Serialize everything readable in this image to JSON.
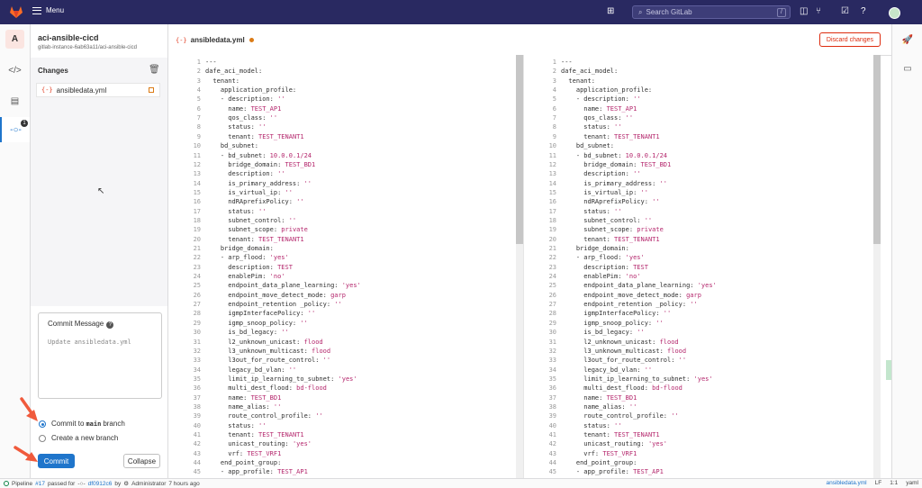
{
  "topbar": {
    "menu_label": "Menu",
    "search_placeholder": "Search GitLab",
    "search_shortcut": "/",
    "icons": [
      "plus-square-icon",
      "search-icon",
      "issues-icon",
      "merge-request-icon",
      "todo-icon",
      "help-icon",
      "user-avatar"
    ]
  },
  "project": {
    "avatar_letter": "A",
    "name": "aci-ansible-cicd",
    "path": "gitlab-instance-6ab63a11/aci-ansible-cicd"
  },
  "left_rail": {
    "items": [
      "edit-icon",
      "review-icon",
      "commit-icon"
    ],
    "commit_badge": "1"
  },
  "changes": {
    "title": "Changes",
    "files": [
      {
        "name": "ansibledata.yml",
        "icon": "yaml-file-icon",
        "status": "modified"
      }
    ]
  },
  "commit": {
    "message_label": "Commit Message",
    "message_placeholder": "Update ansibledata.yml",
    "option_main_prefix": "Commit to",
    "option_main_branch": "main",
    "option_main_suffix": "branch",
    "option_new": "Create a new branch",
    "commit_button": "Commit",
    "collapse_button": "Collapse"
  },
  "editor": {
    "file_tab": "ansibledata.yml",
    "discard_button": "Discard changes",
    "lines": [
      {
        "n": "1",
        "code": "---",
        "val": ""
      },
      {
        "n": "2",
        "code": "dafe_aci_model:",
        "val": ""
      },
      {
        "n": "3",
        "code": "  tenant:",
        "val": ""
      },
      {
        "n": "4",
        "code": "    application_profile:",
        "val": ""
      },
      {
        "n": "5",
        "code": "    - description: ",
        "val": "''"
      },
      {
        "n": "6",
        "code": "      name: ",
        "val": "TEST_AP1"
      },
      {
        "n": "7",
        "code": "      qos_class: ",
        "val": "''"
      },
      {
        "n": "8",
        "code": "      status: ",
        "val": "''"
      },
      {
        "n": "9",
        "code": "      tenant: ",
        "val": "TEST_TENANT1"
      },
      {
        "n": "10",
        "code": "    bd_subnet:",
        "val": ""
      },
      {
        "n": "11",
        "code": "    - bd_subnet: ",
        "val": "10.0.0.1/24"
      },
      {
        "n": "12",
        "code": "      bridge_domain: ",
        "val": "TEST_BD1"
      },
      {
        "n": "13",
        "code": "      description: ",
        "val": "''"
      },
      {
        "n": "14",
        "code": "      is_primary_address: ",
        "val": "''"
      },
      {
        "n": "15",
        "code": "      is_virtual_ip: ",
        "val": "''"
      },
      {
        "n": "16",
        "code": "      ndRAprefixPolicy: ",
        "val": "''"
      },
      {
        "n": "17",
        "code": "      status: ",
        "val": "''"
      },
      {
        "n": "18",
        "code": "      subnet_control: ",
        "val": "''"
      },
      {
        "n": "19",
        "code": "      subnet_scope: ",
        "val": "private"
      },
      {
        "n": "20",
        "code": "      tenant: ",
        "val": "TEST_TENANT1"
      },
      {
        "n": "21",
        "code": "    bridge_domain:",
        "val": ""
      },
      {
        "n": "22",
        "code": "    - arp_flood: ",
        "val": "'yes'"
      },
      {
        "n": "23",
        "code": "      description: ",
        "val": "TEST"
      },
      {
        "n": "24",
        "code": "      enablePim: ",
        "val": "'no'"
      },
      {
        "n": "25",
        "code": "      endpoint_data_plane_learning: ",
        "val": "'yes'"
      },
      {
        "n": "26",
        "code": "      endpoint_move_detect_mode: ",
        "val": "garp"
      },
      {
        "n": "27",
        "code": "      endpoint_retention _policy: ",
        "val": "''"
      },
      {
        "n": "28",
        "code": "      igmpInterfacePolicy: ",
        "val": "''"
      },
      {
        "n": "29",
        "code": "      igmp_snoop_policy: ",
        "val": "''"
      },
      {
        "n": "30",
        "code": "      is_bd_legacy: ",
        "val": "''"
      },
      {
        "n": "31",
        "code": "      l2_unknown_unicast: ",
        "val": "flood"
      },
      {
        "n": "32",
        "code": "      l3_unknown_multicast: ",
        "val": "flood"
      },
      {
        "n": "33",
        "code": "      l3out_for_route_control: ",
        "val": "''"
      },
      {
        "n": "34",
        "code": "      legacy_bd_vlan: ",
        "val": "''"
      },
      {
        "n": "35",
        "code": "      limit_ip_learning_to_subnet: ",
        "val": "'yes'"
      },
      {
        "n": "36",
        "code": "      multi_dest_flood: ",
        "val": "bd-flood"
      },
      {
        "n": "37",
        "code": "      name: ",
        "val": "TEST_BD1"
      },
      {
        "n": "38",
        "code": "      name_alias: ",
        "val": "''"
      },
      {
        "n": "39",
        "code": "      route_control_profile: ",
        "val": "''"
      },
      {
        "n": "40",
        "code": "      status: ",
        "val": "''"
      },
      {
        "n": "41",
        "code": "      tenant: ",
        "val": "TEST_TENANT1"
      },
      {
        "n": "42",
        "code": "      unicast_routing: ",
        "val": "'yes'"
      },
      {
        "n": "43",
        "code": "      vrf: ",
        "val": "TEST_VRF1"
      },
      {
        "n": "44",
        "code": "    end_point_group:",
        "val": ""
      },
      {
        "n": "45",
        "code": "    - app_profile: ",
        "val": "TEST_AP1"
      }
    ]
  },
  "right_rail": [
    "rocket-icon",
    "preview-icon"
  ],
  "status_bar": {
    "pipeline_prefix": "Pipeline",
    "pipeline_id": "#17",
    "pipeline_mid": "passed for",
    "commit_sha": "df0912c6",
    "by": "by",
    "author": "Administrator",
    "time": "7 hours ago",
    "file": "ansibledata.yml",
    "eol": "LF",
    "cursor": "1:1",
    "language": "yaml"
  },
  "colors": {
    "topbar": "#292961",
    "primary": "#1f75cb",
    "danger": "#dd2b0e",
    "string": "#b4266c",
    "arrow": "#f05a3c"
  }
}
